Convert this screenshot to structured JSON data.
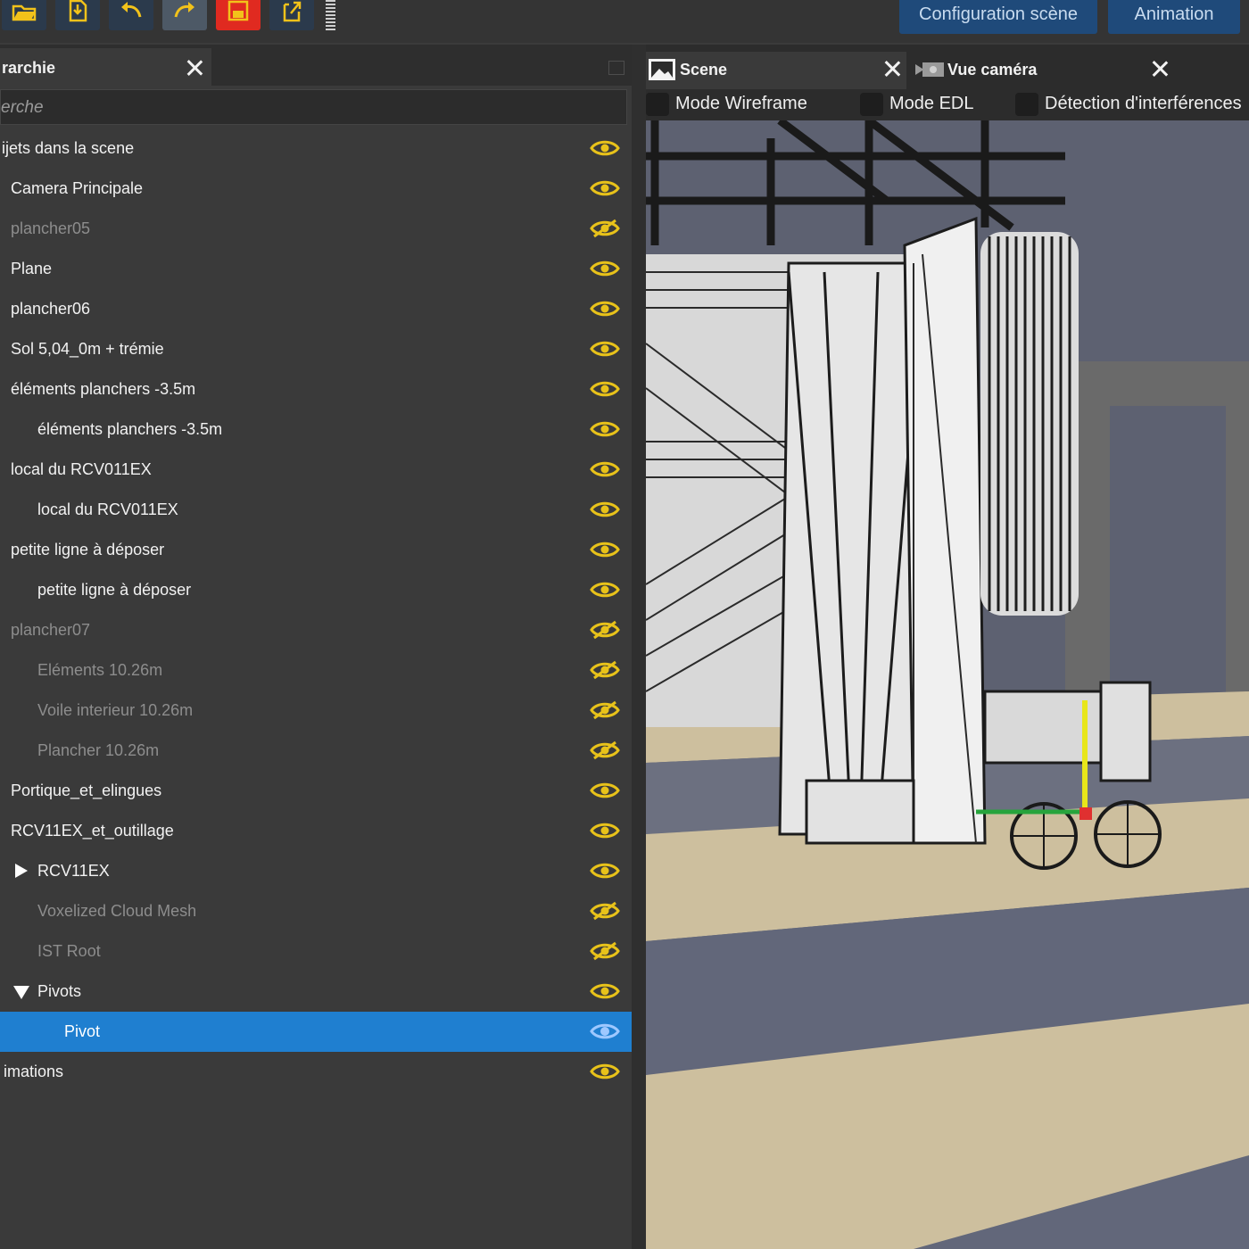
{
  "toolbar": {
    "buttons": [
      {
        "icon": "open-folder-icon"
      },
      {
        "icon": "import-icon"
      },
      {
        "icon": "undo-icon"
      },
      {
        "icon": "redo-icon"
      },
      {
        "icon": "save-icon"
      },
      {
        "icon": "export-icon"
      }
    ],
    "tabs": {
      "config_label": "Configuration scène",
      "animation_label": "Animation"
    }
  },
  "hierarchy": {
    "tab_label": "rarchie",
    "search_placeholder": "erche",
    "rows": [
      {
        "label": "ijets dans la scene",
        "visible": true
      },
      {
        "label": "Camera Principale",
        "visible": true
      },
      {
        "label": "plancher05",
        "visible": false
      },
      {
        "label": "Plane",
        "visible": true
      },
      {
        "label": "plancher06",
        "visible": true
      },
      {
        "label": "Sol 5,04_0m + trémie",
        "visible": true
      },
      {
        "label": "éléments planchers -3.5m",
        "visible": true
      },
      {
        "label": "éléments planchers -3.5m",
        "visible": true
      },
      {
        "label": "local du RCV011EX",
        "visible": true
      },
      {
        "label": "local du RCV011EX",
        "visible": true
      },
      {
        "label": "petite ligne à déposer",
        "visible": true
      },
      {
        "label": "petite ligne à déposer",
        "visible": true
      },
      {
        "label": "plancher07",
        "visible": false
      },
      {
        "label": "Eléments 10.26m",
        "visible": false
      },
      {
        "label": "Voile interieur 10.26m",
        "visible": false
      },
      {
        "label": "Plancher 10.26m",
        "visible": false
      },
      {
        "label": "Portique_et_elingues",
        "visible": true
      },
      {
        "label": "RCV11EX_et_outillage",
        "visible": true
      },
      {
        "label": "RCV11EX",
        "visible": true,
        "expander": "collapsed"
      },
      {
        "label": "Voxelized Cloud Mesh",
        "visible": false
      },
      {
        "label": "IST Root",
        "visible": false
      },
      {
        "label": "Pivots",
        "visible": true,
        "expander": "expanded"
      },
      {
        "label": "Pivot",
        "visible": true,
        "selected": true
      },
      {
        "label": "imations",
        "visible": true
      }
    ]
  },
  "scene": {
    "tabs": [
      {
        "label": "Scene",
        "icon": "scene-image-icon"
      },
      {
        "label": "Vue caméra",
        "icon": "camera-icon"
      }
    ],
    "options": [
      {
        "label": "Mode Wireframe",
        "checked": false
      },
      {
        "label": "Mode EDL",
        "checked": false
      },
      {
        "label": "Détection d'interférences",
        "checked": false
      }
    ]
  },
  "colors": {
    "accent_selection": "#1f7fd0",
    "eye_icon": "#e8c21a",
    "top_tab": "#1f4a7a",
    "save_button": "#e02a20"
  }
}
